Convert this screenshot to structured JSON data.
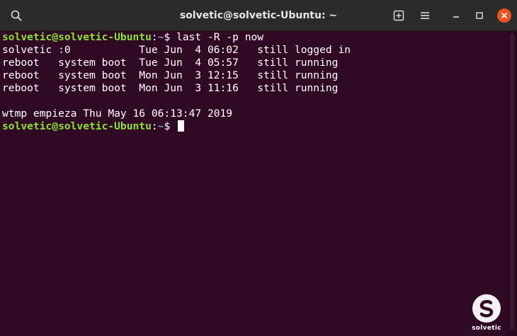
{
  "window": {
    "title": "solvetic@solvetic-Ubuntu: ~"
  },
  "titlebar": {
    "icons": [
      "search-icon",
      "new-tab-icon",
      "hamburger-menu-icon",
      "minimize-icon",
      "maximize-icon",
      "close-icon"
    ]
  },
  "terminal": {
    "prompt": {
      "user_host": "solvetic@solvetic-Ubuntu",
      "colon": ":",
      "path": "~",
      "symbol": "$ "
    },
    "command": "last -R -p now",
    "output": [
      "solvetic :0           Tue Jun  4 06:02   still logged in",
      "reboot   system boot  Tue Jun  4 05:57   still running",
      "reboot   system boot  Mon Jun  3 12:15   still running",
      "reboot   system boot  Mon Jun  3 11:16   still running",
      "",
      "wtmp empieza Thu May 16 06:13:47 2019"
    ]
  },
  "watermark": {
    "text": "solvetic"
  },
  "colors": {
    "terminal_bg": "#300a24",
    "titlebar_bg": "#2b2b2b",
    "prompt_user": "#8ae234",
    "prompt_path": "#729fcf",
    "close_button": "#e95420"
  }
}
